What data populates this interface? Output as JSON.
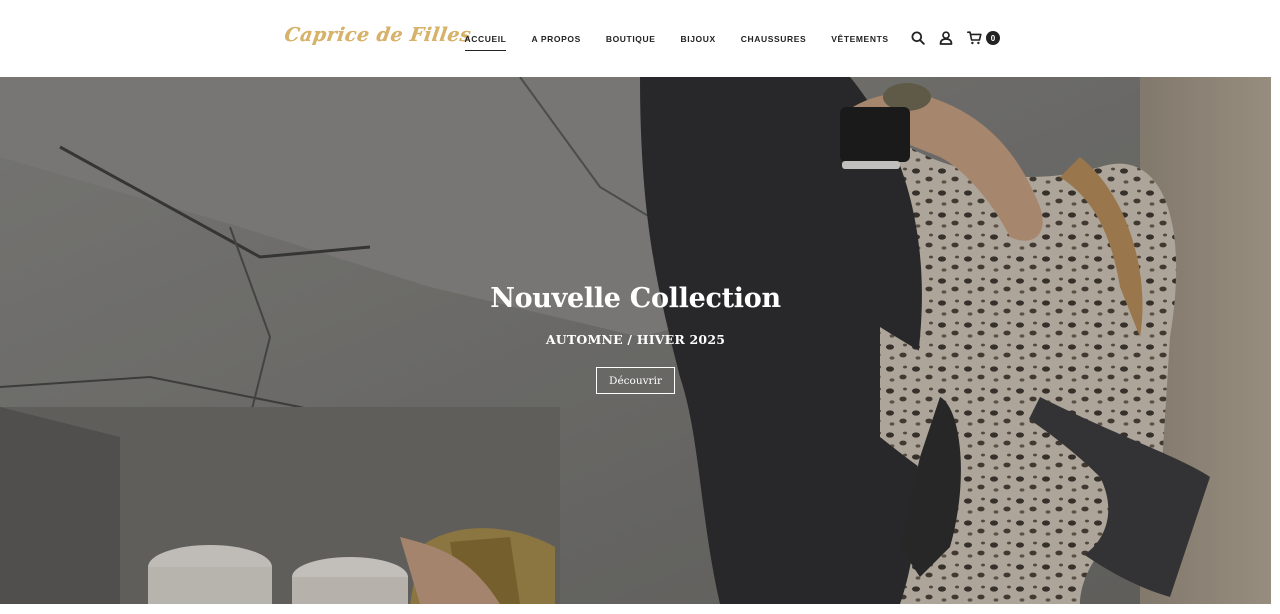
{
  "brand": {
    "logo_text": "Caprice de Filles",
    "logo_color": "#d6b26a"
  },
  "nav": {
    "items": [
      {
        "label": "ACCUEIL",
        "active": true
      },
      {
        "label": "A PROPOS",
        "active": false
      },
      {
        "label": "BOUTIQUE",
        "active": false
      },
      {
        "label": "BIJOUX",
        "active": false
      },
      {
        "label": "CHAUSSURES",
        "active": false
      },
      {
        "label": "VÊTEMENTS",
        "active": false
      }
    ]
  },
  "header_icons": {
    "search": "search-icon",
    "account": "user-icon",
    "cart": "cart-icon",
    "cart_count": "0"
  },
  "hero": {
    "title": "Nouvelle Collection",
    "subtitle": "AUTOMNE / HIVER 2025",
    "cta_label": "Découvrir"
  }
}
